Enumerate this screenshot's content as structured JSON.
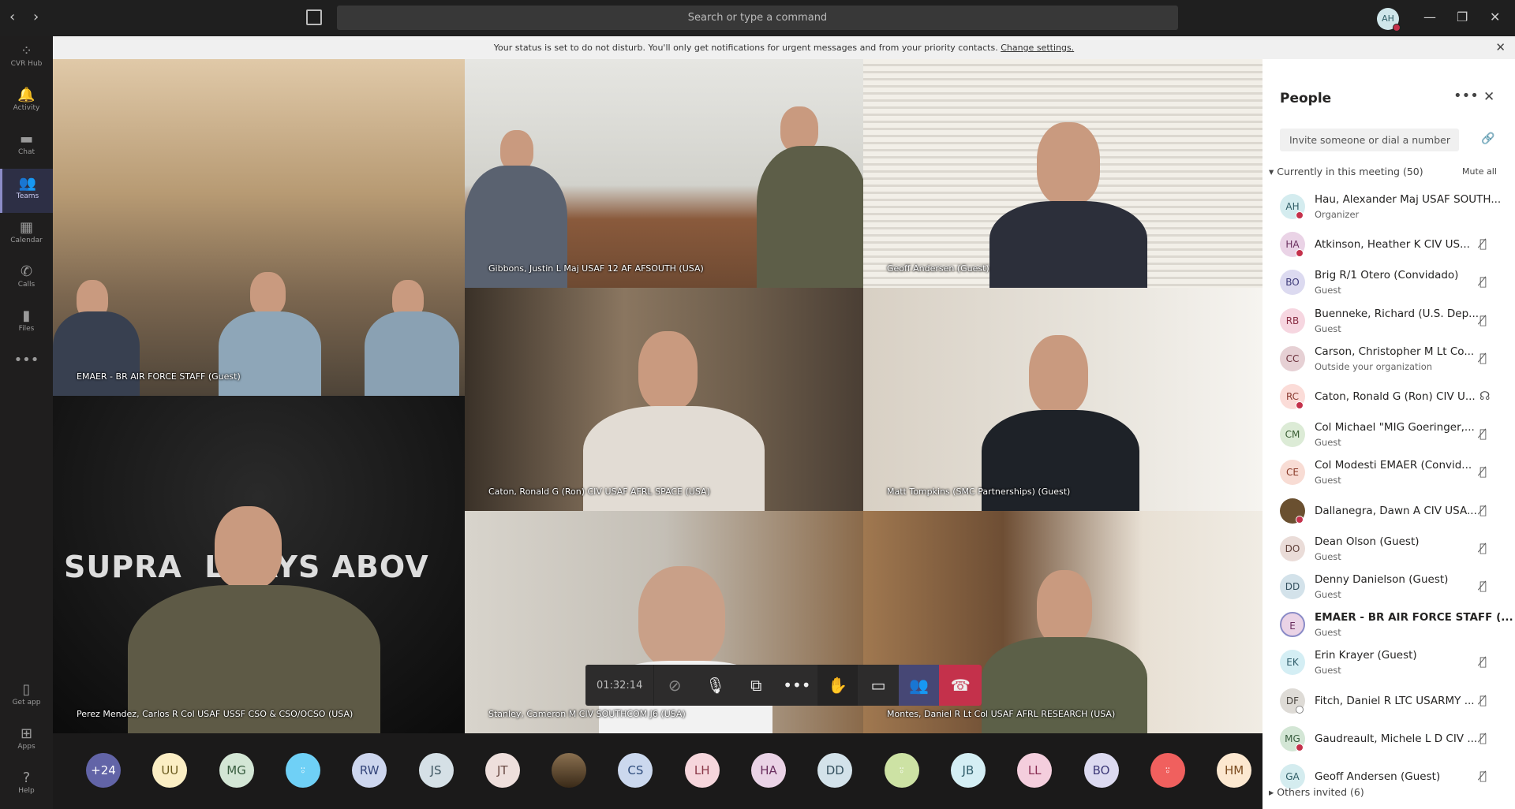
{
  "topbar": {
    "search_placeholder": "Search or type a command",
    "user_initials": "AH",
    "back": "‹",
    "forward": "›",
    "minimize": "—",
    "restore": "❐",
    "close": "✕"
  },
  "rail": [
    {
      "label": "CVR Hub",
      "icon": "⁘"
    },
    {
      "label": "Activity",
      "icon": "🔔"
    },
    {
      "label": "Chat",
      "icon": "▬"
    },
    {
      "label": "Teams",
      "icon": "👥",
      "active": true
    },
    {
      "label": "Calendar",
      "icon": "▦"
    },
    {
      "label": "Calls",
      "icon": "✆"
    },
    {
      "label": "Files",
      "icon": "▮"
    },
    {
      "label": "",
      "icon": "•••"
    }
  ],
  "rail_bottom": [
    {
      "label": "Get app",
      "icon": "▯"
    },
    {
      "label": "Apps",
      "icon": "⊞"
    },
    {
      "label": "Help",
      "icon": "?"
    }
  ],
  "banner": {
    "text": "Your status is set to do not disturb. You'll only get notifications for urgent messages and from your priority contacts.",
    "link": "Change settings."
  },
  "tiles": [
    "EMAER - BR AIR FORCE STAFF (Guest)",
    "Perez Mendez, Carlos R Col USAF USSF CSO & CSO/OCSO (USA)",
    "Gibbons, Justin L Maj USAF 12 AF AFSOUTH (USA)",
    "Caton, Ronald G (Ron) CIV USAF AFRL SPACE (USA)",
    "Stanley, Cameron M CIV SOUTHCOM J6 (USA)",
    "Geoff Andersen (Guest)",
    "Matt Tompkins (SMC Partnerships) (Guest)",
    "Montes, Daniel R Lt Col USAF AFRL RESEARCH (USA)"
  ],
  "tile_banner_text": "SUPRA  LWAYS ABOV",
  "controls": {
    "timer": "01:32:14"
  },
  "strip": [
    {
      "t": "+24",
      "bg": "#6264a7",
      "fg": "#fff"
    },
    {
      "t": "UU",
      "bg": "#fbeec4",
      "fg": "#6b5b1e"
    },
    {
      "t": "MG",
      "bg": "#d3e6d5",
      "fg": "#375c3e"
    },
    {
      "t": "person",
      "bg": "#6fd0f6",
      "fg": "#fff"
    },
    {
      "t": "RW",
      "bg": "#cdd6ee",
      "fg": "#34457a"
    },
    {
      "t": "JS",
      "bg": "#d5e0e6",
      "fg": "#3d5560"
    },
    {
      "t": "JT",
      "bg": "#eedfdc",
      "fg": "#6a4a44"
    },
    {
      "t": "photo",
      "bg": "#6a5030",
      "fg": "#fff"
    },
    {
      "t": "CS",
      "bg": "#cbd8ee",
      "fg": "#2f4d7d"
    },
    {
      "t": "LH",
      "bg": "#f6d6dc",
      "fg": "#8a3848"
    },
    {
      "t": "HA",
      "bg": "#ead3e6",
      "fg": "#6a2f5f"
    },
    {
      "t": "DD",
      "bg": "#d3e2ea",
      "fg": "#34505e"
    },
    {
      "t": "person",
      "bg": "#cde2a4",
      "fg": "#fff"
    },
    {
      "t": "JB",
      "bg": "#d4eef4",
      "fg": "#2f5d6a"
    },
    {
      "t": "LL",
      "bg": "#f4cedd",
      "fg": "#8a2f55"
    },
    {
      "t": "BO",
      "bg": "#dcdaf0",
      "fg": "#3d3a78"
    },
    {
      "t": "person",
      "bg": "#f0605e",
      "fg": "#fff"
    },
    {
      "t": "HM",
      "bg": "#fce8d0",
      "fg": "#7a4a1e"
    }
  ],
  "people": {
    "title": "People",
    "invite_placeholder": "Invite someone or dial a number",
    "section": "Currently in this meeting (50)",
    "mute_all": "Mute all",
    "others": "Others invited (6)",
    "list": [
      {
        "i": "AH",
        "bg": "#d4ecef",
        "fg": "#2f5d66",
        "name": "Hau, Alexander Maj USAF SOUTH...",
        "sub": "Organizer",
        "status": "dnd",
        "mic": ""
      },
      {
        "i": "HA",
        "bg": "#ead3e6",
        "fg": "#6a2f5f",
        "name": "Atkinson, Heather K CIV US...",
        "sub": "",
        "status": "busy",
        "mic": "muted"
      },
      {
        "i": "BO",
        "bg": "#dcdaf0",
        "fg": "#3d3a78",
        "name": "Brig R/1 Otero (Convidado)",
        "sub": "Guest",
        "status": "",
        "mic": "muted"
      },
      {
        "i": "RB",
        "bg": "#f6d6e0",
        "fg": "#8a2f45",
        "name": "Buenneke, Richard (U.S. Dep...",
        "sub": "Guest",
        "status": "",
        "mic": "muted"
      },
      {
        "i": "CC",
        "bg": "#e6d0d4",
        "fg": "#6a2f3a",
        "name": "Carson, Christopher M Lt Co...",
        "sub": "Outside your organization",
        "status": "",
        "mic": "muted"
      },
      {
        "i": "RC",
        "bg": "#fbdcd8",
        "fg": "#8a3a30",
        "name": "Caton, Ronald G (Ron) CIV U...",
        "sub": "",
        "status": "busy",
        "mic": "speaking"
      },
      {
        "i": "CM",
        "bg": "#dcebd6",
        "fg": "#3a5e34",
        "name": "Col Michael \"MIG Goeringer,...",
        "sub": "Guest",
        "status": "",
        "mic": "muted"
      },
      {
        "i": "CE",
        "bg": "#f8dcd4",
        "fg": "#8a3a28",
        "name": "Col Modesti EMAER (Convid...",
        "sub": "Guest",
        "status": "",
        "mic": "muted"
      },
      {
        "i": "",
        "bg": "#6a5030",
        "fg": "#fff",
        "name": "Dallanegra, Dawn A CIV USA...",
        "sub": "",
        "status": "busy",
        "mic": "muted"
      },
      {
        "i": "DO",
        "bg": "#eadcd8",
        "fg": "#5e3f38",
        "name": "Dean Olson (Guest)",
        "sub": "Guest",
        "status": "",
        "mic": "muted"
      },
      {
        "i": "DD",
        "bg": "#d3e2ea",
        "fg": "#34505e",
        "name": "Denny Danielson (Guest)",
        "sub": "Guest",
        "status": "",
        "mic": "muted"
      },
      {
        "i": "E",
        "bg": "#ead3e6",
        "fg": "#6a2f5f",
        "name": "EMAER - BR AIR FORCE STAFF (...",
        "sub": "Guest",
        "status": "",
        "mic": "",
        "bold": true
      },
      {
        "i": "EK",
        "bg": "#d4eef4",
        "fg": "#2f5d6a",
        "name": "Erin Krayer (Guest)",
        "sub": "Guest",
        "status": "",
        "mic": "muted"
      },
      {
        "i": "DF",
        "bg": "#dedbd6",
        "fg": "#4a4640",
        "name": "Fitch, Daniel R LTC USARMY ...",
        "sub": "",
        "status": "offline",
        "mic": "muted"
      },
      {
        "i": "MG",
        "bg": "#d3e6d5",
        "fg": "#375c3e",
        "name": "Gaudreault, Michele L D CIV ...",
        "sub": "",
        "status": "busy",
        "mic": "muted"
      },
      {
        "i": "GA",
        "bg": "#d4ecef",
        "fg": "#2f5d66",
        "name": "Geoff Andersen (Guest)",
        "sub": "",
        "status": "",
        "mic": "muted"
      }
    ]
  }
}
